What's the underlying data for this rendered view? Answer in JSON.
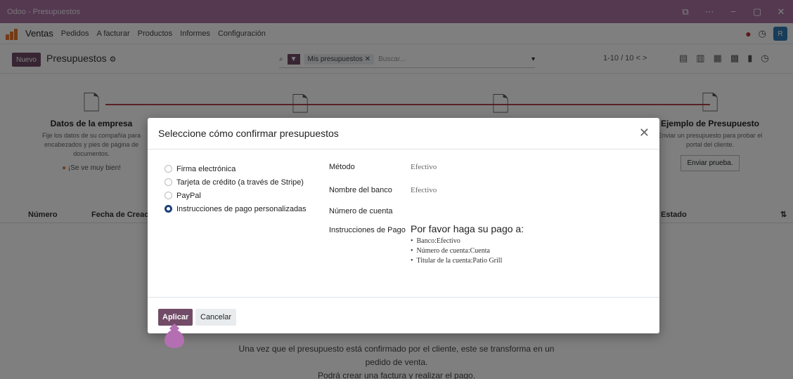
{
  "window": {
    "title": "Odoo - Presupuestos"
  },
  "navbar": {
    "app_name": "Ventas",
    "menu": [
      "Pedidos",
      "A facturar",
      "Productos",
      "Informes",
      "Configuración"
    ],
    "avatar": "R"
  },
  "control": {
    "new_button": "Nuevo",
    "breadcrumb": "Presupuestos",
    "search_facet": "Mis presupuestos",
    "search_placeholder": "Buscar...",
    "pager": "1-10 / 10"
  },
  "onboarding": {
    "steps": [
      {
        "title": "Datos de la empresa",
        "desc": "Fije los datos de su compañía para encabezados y pies de página de documentos.",
        "action": "¡Se ve muy bien!"
      },
      {
        "title": "Ejemplo de Presupuesto",
        "desc": "Enviar un presupuesto para probar el portal del cliente.",
        "action": "Enviar prueba."
      }
    ]
  },
  "table": {
    "columns": [
      "Número",
      "Fecha de Creació",
      "Estado"
    ]
  },
  "empty_message": {
    "line1": "Una vez que el presupuesto está confirmado por el cliente, este se transforma en un",
    "line2": "pedido de venta.",
    "line3": "Podrá crear una factura y realizar el pago."
  },
  "modal": {
    "title": "Seleccione cómo confirmar presupuestos",
    "options": [
      {
        "label": "Firma electrónica",
        "selected": false
      },
      {
        "label": "Tarjeta de crédito (a través de Stripe)",
        "selected": false
      },
      {
        "label": "PayPal",
        "selected": false
      },
      {
        "label": "Instrucciones de pago personalizadas",
        "selected": true
      }
    ],
    "fields": {
      "method_label": "Método",
      "method_value": "Efectivo",
      "bank_label": "Nombre del banco",
      "bank_value": "Efectivo",
      "account_label": "Número de cuenta",
      "instructions_label": "Instrucciones de Pago",
      "instructions_heading": "Por favor haga su pago a:",
      "instructions_bullets": [
        "Banco:Efectivo",
        "Número de cuenta:Cuenta",
        "Titular de la cuenta:Patio Grill"
      ]
    },
    "apply_button": "Aplicar",
    "cancel_button": "Cancelar"
  },
  "colors": {
    "brand": "#714b67",
    "titlebar": "#a873a3",
    "radio_selected": "#1c3f7a"
  }
}
